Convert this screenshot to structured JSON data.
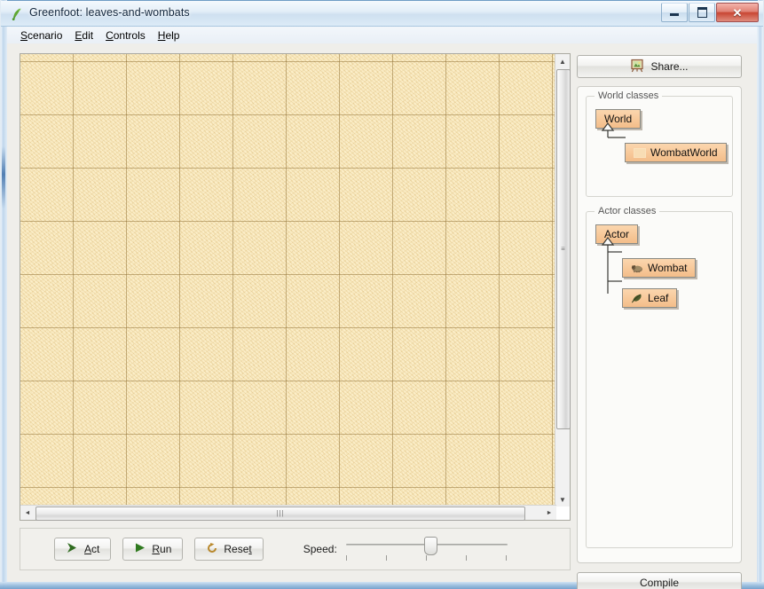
{
  "window": {
    "title": "Greenfoot: leaves-and-wombats",
    "icon": "greenfoot-logo-icon",
    "buttons": {
      "minimize": "minimize-button",
      "maximize": "maximize-button",
      "close_glyph": "✕"
    }
  },
  "menubar": {
    "items": [
      {
        "label": "Scenario",
        "mnemonic": "S",
        "rest": "cenario"
      },
      {
        "label": "Edit",
        "mnemonic": "E",
        "rest": "dit"
      },
      {
        "label": "Controls",
        "mnemonic": "C",
        "rest": "ontrols"
      },
      {
        "label": "Help",
        "mnemonic": "H",
        "rest": "elp"
      }
    ]
  },
  "world": {
    "background_color": "#f6e0a6",
    "gridline_color": "#96783e",
    "cell_size": 60,
    "scrollbars": {
      "vertical_up": "▲",
      "vertical_down": "▼",
      "horizontal_left": "◄",
      "horizontal_right": "►",
      "grip": "⦀"
    }
  },
  "controls": {
    "act": {
      "label": "Act",
      "mnemonic": "A",
      "rest": "ct",
      "icon": "chevron-right-icon"
    },
    "run": {
      "label": "Run",
      "mnemonic": "R",
      "rest": "un",
      "icon": "play-triangle-icon"
    },
    "reset": {
      "label": "Reset",
      "pre": "Rese",
      "mnemonic": "t",
      "icon": "reset-circular-arrow-icon"
    },
    "speed_label": "Speed:",
    "speed_value": 52,
    "speed_ticks": 5
  },
  "sidebar": {
    "share_button": {
      "label": "Share...",
      "icon": "share-easel-icon"
    },
    "compile_button": {
      "label": "Compile"
    },
    "world_classes": {
      "title": "World classes",
      "root": {
        "name": "World",
        "icon": null
      },
      "children": [
        {
          "name": "WombatWorld",
          "icon": "wombat-world-image-icon"
        }
      ]
    },
    "actor_classes": {
      "title": "Actor classes",
      "root": {
        "name": "Actor",
        "icon": null
      },
      "children": [
        {
          "name": "Wombat",
          "icon": "wombat-icon"
        },
        {
          "name": "Leaf",
          "icon": "leaf-icon"
        }
      ]
    }
  },
  "colors": {
    "class_box_fill": "#f8cb9d",
    "class_box_border": "#8a8a84",
    "world_sand": "#f6e0a6",
    "accent_blue": "#3d6fa8"
  }
}
